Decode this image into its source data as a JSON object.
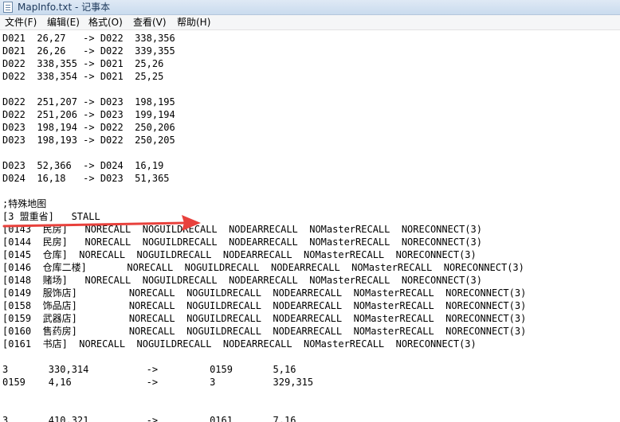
{
  "window": {
    "title": "MapInfo.txt - 记事本",
    "icon": "notepad-icon"
  },
  "menu": [
    "文件(F)",
    "编辑(E)",
    "格式(O)",
    "查看(V)",
    "帮助(H)"
  ],
  "lines": [
    "D021  26,27   -> D022  338,356",
    "D021  26,26   -> D022  339,355",
    "D022  338,355 -> D021  25,26",
    "D022  338,354 -> D021  25,25",
    "",
    "D022  251,207 -> D023  198,195",
    "D022  251,206 -> D023  199,194",
    "D023  198,194 -> D022  250,206",
    "D023  198,193 -> D022  250,205",
    "",
    "D023  52,366  -> D024  16,19",
    "D024  16,18   -> D023  51,365",
    "",
    ";特殊地图",
    "[3 盟重省]   STALL",
    "[0143  民房]   NORECALL  NOGUILDRECALL  NODEARRECALL  NOMasterRECALL  NORECONNECT(3)",
    "[0144  民房]   NORECALL  NOGUILDRECALL  NODEARRECALL  NOMasterRECALL  NORECONNECT(3)",
    "[0145  仓库]  NORECALL  NOGUILDRECALL  NODEARRECALL  NOMasterRECALL  NORECONNECT(3)",
    "[0146  仓库二楼]       NORECALL  NOGUILDRECALL  NODEARRECALL  NOMasterRECALL  NORECONNECT(3)",
    "[0148  赌场]   NORECALL  NOGUILDRECALL  NODEARRECALL  NOMasterRECALL  NORECONNECT(3)",
    "[0149  服饰店]         NORECALL  NOGUILDRECALL  NODEARRECALL  NOMasterRECALL  NORECONNECT(3)",
    "[0158  饰品店]         NORECALL  NOGUILDRECALL  NODEARRECALL  NOMasterRECALL  NORECONNECT(3)",
    "[0159  武器店]         NORECALL  NOGUILDRECALL  NODEARRECALL  NOMasterRECALL  NORECONNECT(3)",
    "[0160  售药房]         NORECALL  NOGUILDRECALL  NODEARRECALL  NOMasterRECALL  NORECONNECT(3)",
    "[0161  书店]  NORECALL  NOGUILDRECALL  NODEARRECALL  NOMasterRECALL  NORECONNECT(3)",
    "",
    "3       330,314          ->         0159       5,16",
    "0159    4,16             ->         3          329,315",
    "",
    "",
    "3       410,321          ->         0161       7,16"
  ],
  "annotation": {
    "arrow_color": "#e8413c"
  }
}
